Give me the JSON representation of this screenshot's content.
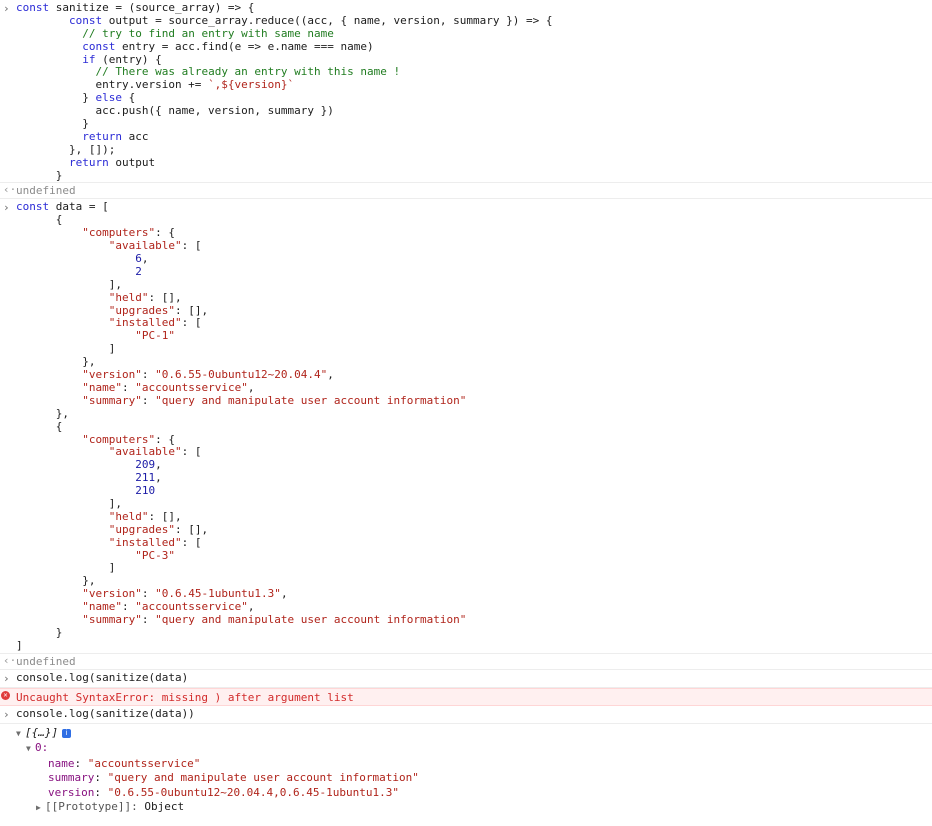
{
  "prompt_symbol": "›",
  "result_symbol": "‹·",
  "blocks": {
    "sanitize": {
      "lines": [
        "const sanitize = (source_array) => {",
        "        const output = source_array.reduce((acc, { name, version, summary }) => {",
        "          // try to find an entry with same name",
        "          const entry = acc.find(e => e.name === name)",
        "          if (entry) {",
        "            // There was already an entry with this name !",
        "            entry.version += `,${version}`",
        "          } else {",
        "            acc.push({ name, version, summary })",
        "          }",
        "          return acc",
        "        }, []);",
        "        return output",
        "      }"
      ],
      "result": "undefined"
    },
    "data": {
      "lines": [
        "const data = [",
        "      {",
        "          \"computers\": {",
        "              \"available\": [",
        "                  6,",
        "                  2",
        "              ],",
        "              \"held\": [],",
        "              \"upgrades\": [],",
        "              \"installed\": [",
        "                  \"PC-1\"",
        "              ]",
        "          },",
        "          \"version\": \"0.6.55-0ubuntu12~20.04.4\",",
        "          \"name\": \"accountsservice\",",
        "          \"summary\": \"query and manipulate user account information\"",
        "      },",
        "      {",
        "          \"computers\": {",
        "              \"available\": [",
        "                  209,",
        "                  211,",
        "                  210",
        "              ],",
        "              \"held\": [],",
        "              \"upgrades\": [],",
        "              \"installed\": [",
        "                  \"PC-3\"",
        "              ]",
        "          },",
        "          \"version\": \"0.6.45-1ubuntu1.3\",",
        "          \"name\": \"accountsservice\",",
        "          \"summary\": \"query and manipulate user account information\"",
        "      }",
        "]"
      ],
      "result": "undefined"
    },
    "call1": {
      "line": "console.log(sanitize(data)",
      "error": "Uncaught SyntaxError: missing ) after argument list",
      "error_icon": "✕"
    },
    "call2": {
      "line": "console.log(sanitize(data))",
      "tree": {
        "root_label": "[{…}]",
        "info_badge": "i",
        "item_index": "0:",
        "props": [
          {
            "key": "name",
            "value": "\"accountsservice\""
          },
          {
            "key": "summary",
            "value": "\"query and manipulate user account information\""
          },
          {
            "key": "version",
            "value": "\"0.6.55-0ubuntu12~20.04.4,0.6.45-1ubuntu1.3\""
          }
        ],
        "prototype_key": "[[Prototype]]",
        "prototype_value": "Object"
      }
    }
  },
  "colors": {
    "keyword": "#2b2bd6",
    "comment": "#207c20",
    "string": "#b0241b",
    "number": "#1a1aa6",
    "error": "#d22b2b",
    "error_bg": "#fff0f0"
  }
}
